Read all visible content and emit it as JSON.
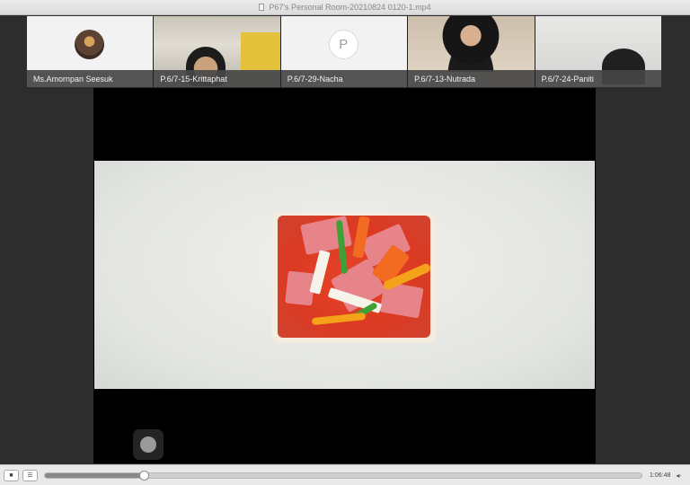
{
  "window": {
    "title": "P67's Personal Room-20210824 0120-1.mp4"
  },
  "participants": [
    {
      "name": "Ms.Amornpan Seesuk",
      "avatar": "photo"
    },
    {
      "name": "P.6/7-15-Krittaphat",
      "avatar": "camera"
    },
    {
      "name": "P.6/7-29-Nacha",
      "avatar": "letter",
      "initial": "P"
    },
    {
      "name": "P.6/7-13-Nutrada",
      "avatar": "camera"
    },
    {
      "name": "P.6/7-24-Paniti",
      "avatar": "camera"
    }
  ],
  "player": {
    "progress": 0.165,
    "timecode": "1:06:48",
    "stop_icon": "stop-icon",
    "menu_icon": "list-icon",
    "volume_icon": "speaker-icon"
  },
  "colors": {
    "sauce": "#db3a22",
    "bread": "#f3ecdf",
    "ham": "#e6848a",
    "carrot": "#f36a23"
  }
}
